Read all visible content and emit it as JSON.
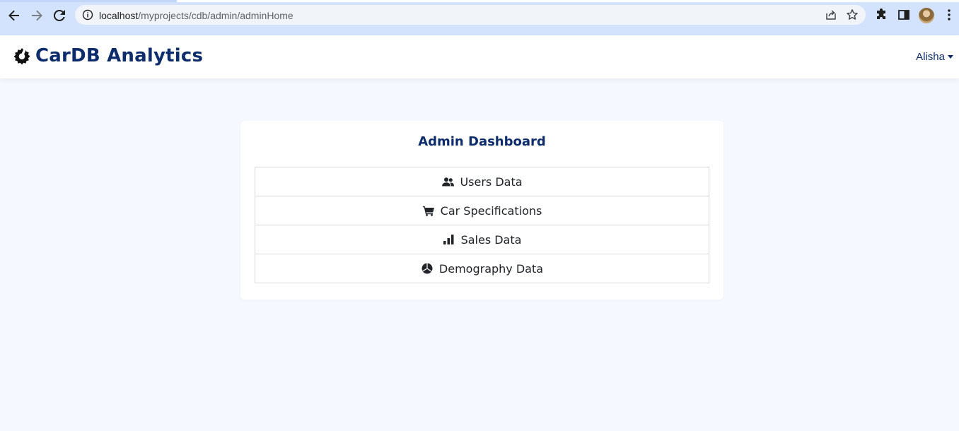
{
  "browser": {
    "url_host": "localhost",
    "url_path": "/myprojects/cdb/admin/adminHome"
  },
  "navbar": {
    "brand": "CarDB Analytics",
    "user": "Alisha"
  },
  "dashboard": {
    "title": "Admin Dashboard",
    "items": [
      {
        "label": "Users Data",
        "icon": "users-icon"
      },
      {
        "label": "Car Specifications",
        "icon": "cart-icon"
      },
      {
        "label": "Sales Data",
        "icon": "bar-chart-icon"
      },
      {
        "label": "Demography Data",
        "icon": "pie-chart-icon"
      }
    ]
  },
  "colors": {
    "brand": "#0d2c6c",
    "page_bg": "#f5f8ff",
    "chrome_bg": "#d3e3fd"
  }
}
